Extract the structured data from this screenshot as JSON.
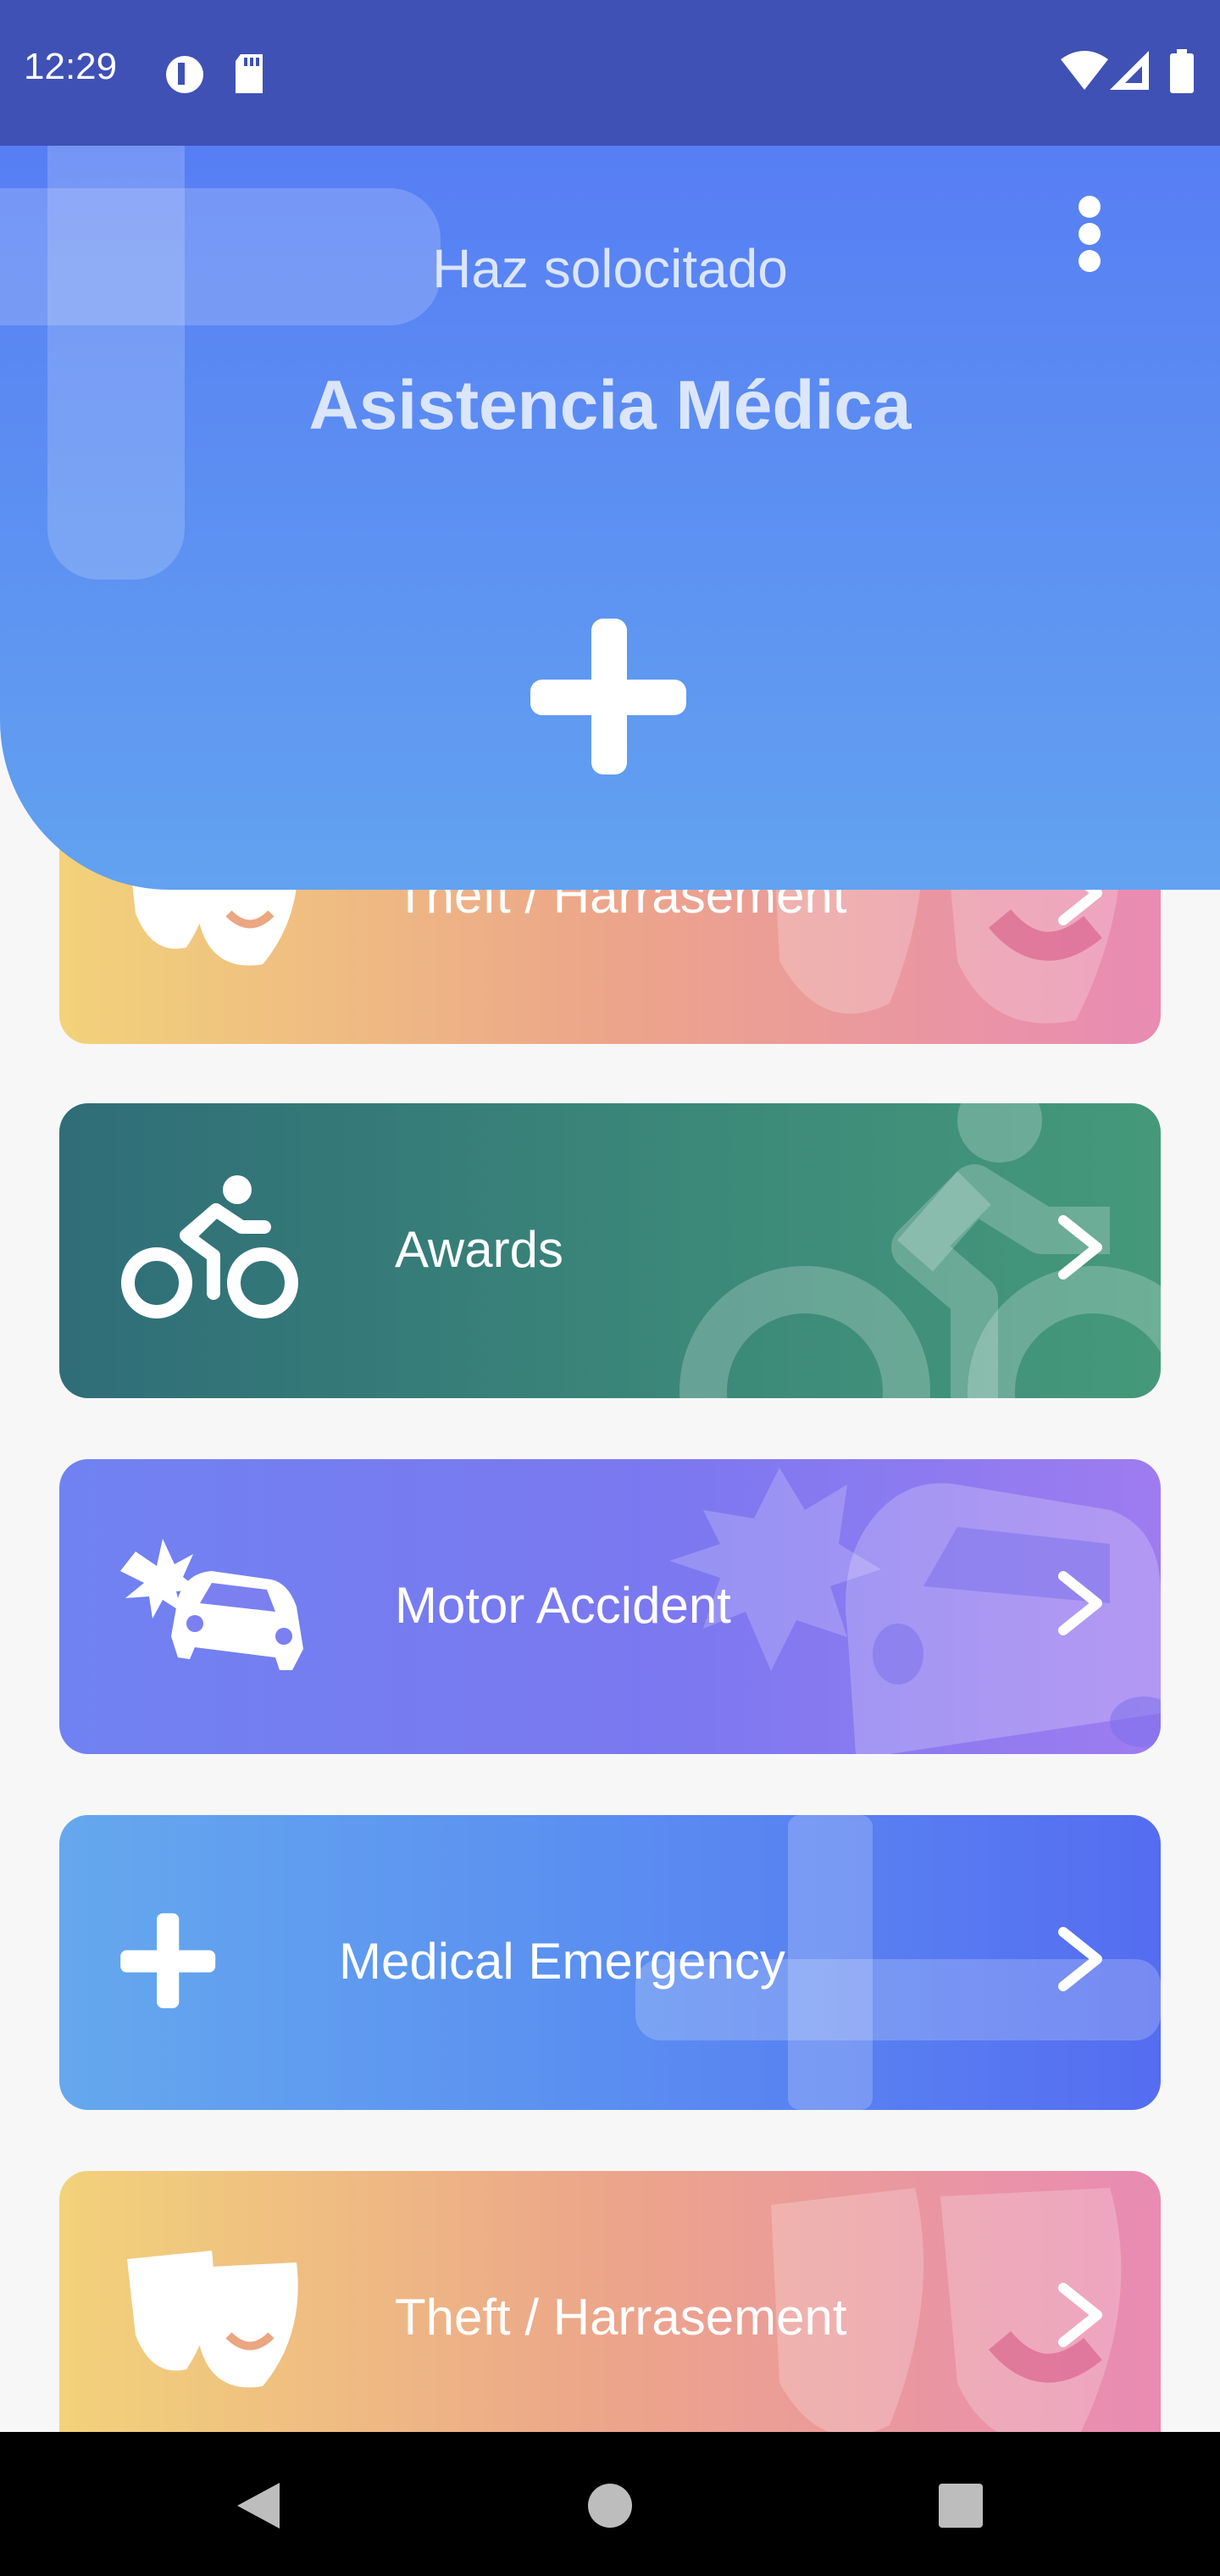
{
  "status_bar": {
    "time": "12:29",
    "icons": [
      "data-saver-icon",
      "sd-card-icon",
      "wifi-icon",
      "signal-icon",
      "battery-icon"
    ]
  },
  "header": {
    "subtitle": "Haz solocitado",
    "title": "Asistencia Médica",
    "menu_icon": "more-vertical-icon",
    "action_icon": "plus-icon"
  },
  "cards": [
    {
      "label": "Theft / Harrasement",
      "icon": "theater-masks-icon",
      "style": "theft"
    },
    {
      "label": "Awards",
      "icon": "bicycle-icon",
      "style": "awards"
    },
    {
      "label": "Motor Accident",
      "icon": "car-crash-icon",
      "style": "motor"
    },
    {
      "label": "Medical Emergency",
      "icon": "plus-icon",
      "style": "medical"
    },
    {
      "label": "Theft / Harrasement",
      "icon": "theater-masks-icon",
      "style": "theft"
    }
  ],
  "nav_bar": {
    "icons": [
      "back-icon",
      "home-icon",
      "recents-icon"
    ]
  },
  "colors": {
    "status_bar": "#3f51b5",
    "header_top": "#577ef4",
    "header_bottom": "#62a2f0",
    "theft_gradient": [
      "#f2d27a",
      "#eca58a",
      "#e98bb3"
    ],
    "awards_gradient": [
      "#2f6d78",
      "#45997a"
    ],
    "motor_gradient": [
      "#7082f1",
      "#9e7cf0"
    ],
    "medical_gradient": [
      "#65a8ee",
      "#556df1"
    ]
  }
}
